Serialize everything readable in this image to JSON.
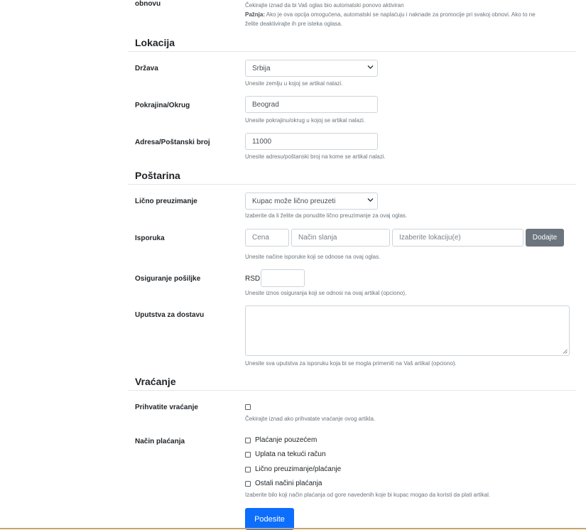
{
  "renewal": {
    "label": "obnovu",
    "help_line1": "Čekirajte iznad da bi Vaš oglas bio automatski ponovo aktiviran",
    "help_strong": "Pažnja:",
    "help_line2a": " Ako je ova opcija omogućena, automatski se naplaćuju i naknade za promocije pri svakoj obnovi. Ako to ne",
    "help_line3": "želite deaktivirajte ih pre isteka oglasa."
  },
  "location": {
    "title": "Lokacija",
    "country": {
      "label": "Država",
      "value": "Srbija",
      "help": "Unesite zemlju u kojoj se artikal nalazi."
    },
    "region": {
      "label": "Pokrajina/Okrug",
      "value": "Beograd",
      "help": "Unesite pokrajinu/okrug u kojoj se artikal nalazi."
    },
    "address": {
      "label": "Adresa/Poštanski broj",
      "value": "11000",
      "help": "Unesite adresu/poštanski broj na kome se artikal nalazi."
    }
  },
  "shipping": {
    "title": "Poštarina",
    "pickup": {
      "label": "Lično preuzimanje",
      "value": "Kupac može lično preuzeti",
      "help": "Izaberite da li želite da ponudite lično preuzimanje za ovaj oglas."
    },
    "delivery": {
      "label": "Isporuka",
      "price_placeholder": "Cena",
      "method_placeholder": "Način slanja",
      "locations_placeholder": "Izaberite lokaciju(e)",
      "add_button": "Dodajte",
      "help": "Unesite načine isporuke koji se odnose na ovaj oglas."
    },
    "insurance": {
      "label": "Osiguranje pošiljke",
      "currency": "RSD",
      "value": "",
      "help": "Unesite iznos osiguranja koji se odnosi na ovaj artikal (opciono)."
    },
    "instructions": {
      "label": "Uputstva za dostavu",
      "value": "",
      "help": "Unesite sva uputstva za isporuku koja bi se mogla primeniti na Vaš artikal (opciono)."
    }
  },
  "returns": {
    "title": "Vraćanje",
    "accept": {
      "label": "Prihvatite vraćanje",
      "checked": false,
      "help": "Čekirajte iznad ako prihvatate vraćanje ovog artikla."
    },
    "payment": {
      "label": "Način plaćanja",
      "options": [
        {
          "label": "Plaćanje pouzećem",
          "checked": false
        },
        {
          "label": "Uplata na tekući račun",
          "checked": false
        },
        {
          "label": "Lično preuzimanje/plaćanje",
          "checked": false
        },
        {
          "label": "Ostali načini plaćanja",
          "checked": false
        }
      ],
      "help": "Izaberite bilo koji način plaćanja od gore navedenih koje bi kupac mogao da koristi da plati artikal."
    }
  },
  "submit": {
    "label": "Podesite"
  },
  "colors": {
    "primary": "#0d6efd",
    "secondary": "#6c757d",
    "muted": "#6c757d",
    "border": "#ced4da"
  },
  "icons": {
    "select_arrow": "chevron-down-icon",
    "textarea_resize": "resize-grip-icon"
  }
}
